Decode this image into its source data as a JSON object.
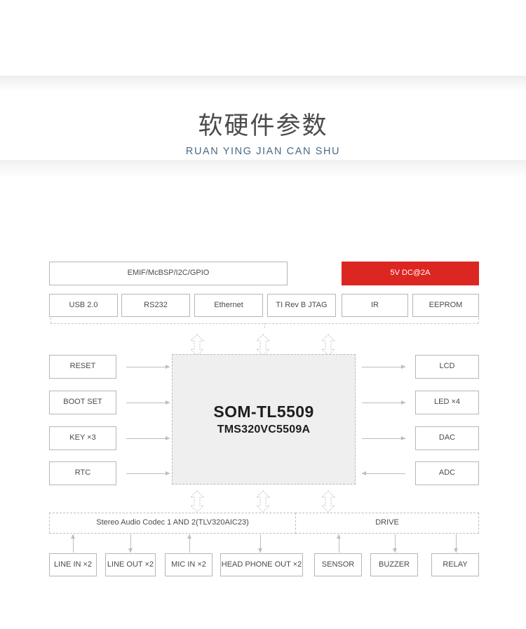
{
  "header": {
    "title_cn": "软硬件参数",
    "title_pinyin": "RUAN YING JIAN CAN SHU",
    "accent_color": "#4a6a86"
  },
  "diagram": {
    "type": "block-diagram",
    "colors": {
      "power_box": "#dc2622",
      "chip_fill": "#efefef",
      "border": "#b6b6b6",
      "dashed_border": "#bdbdbd",
      "arrow": "#bdbdbd"
    },
    "bus_row": [
      {
        "label": "EMIF/McBSP/I2C/GPIO",
        "style": "plain"
      },
      {
        "label": "5V DC@2A",
        "style": "power"
      }
    ],
    "peripheral_row": [
      {
        "label": "USB 2.0"
      },
      {
        "label": "RS232"
      },
      {
        "label": "Ethernet"
      },
      {
        "label": "TI Rev B JTAG"
      },
      {
        "label": "IR"
      },
      {
        "label": "EEPROM"
      }
    ],
    "chip": {
      "title": "SOM-TL5509",
      "subtitle": "TMS320VC5509A"
    },
    "left_nodes": [
      {
        "label": "RESET",
        "arrow": "right"
      },
      {
        "label": "BOOT SET",
        "arrow": "right"
      },
      {
        "label": "KEY  ×3",
        "arrow": "right"
      },
      {
        "label": "RTC",
        "arrow": "right"
      }
    ],
    "right_nodes": [
      {
        "label": "LCD",
        "arrow": "right"
      },
      {
        "label": "LED  ×4",
        "arrow": "right"
      },
      {
        "label": "DAC",
        "arrow": "right"
      },
      {
        "label": "ADC",
        "arrow": "left"
      }
    ],
    "codec_row": [
      {
        "label": "Stereo Audio Codec 1 AND 2(TLV320AIC23)"
      },
      {
        "label": "DRIVE"
      }
    ],
    "io_row": [
      {
        "label": "LINE IN ×2",
        "arrow": "up"
      },
      {
        "label": "LINE OUT ×2",
        "arrow": "down"
      },
      {
        "label": "MIC IN ×2",
        "arrow": "up"
      },
      {
        "label": "HEAD PHONE OUT ×2",
        "arrow": "down"
      },
      {
        "label": "SENSOR",
        "arrow": "up"
      },
      {
        "label": "BUZZER",
        "arrow": "down"
      },
      {
        "label": "RELAY",
        "arrow": "down"
      }
    ]
  }
}
